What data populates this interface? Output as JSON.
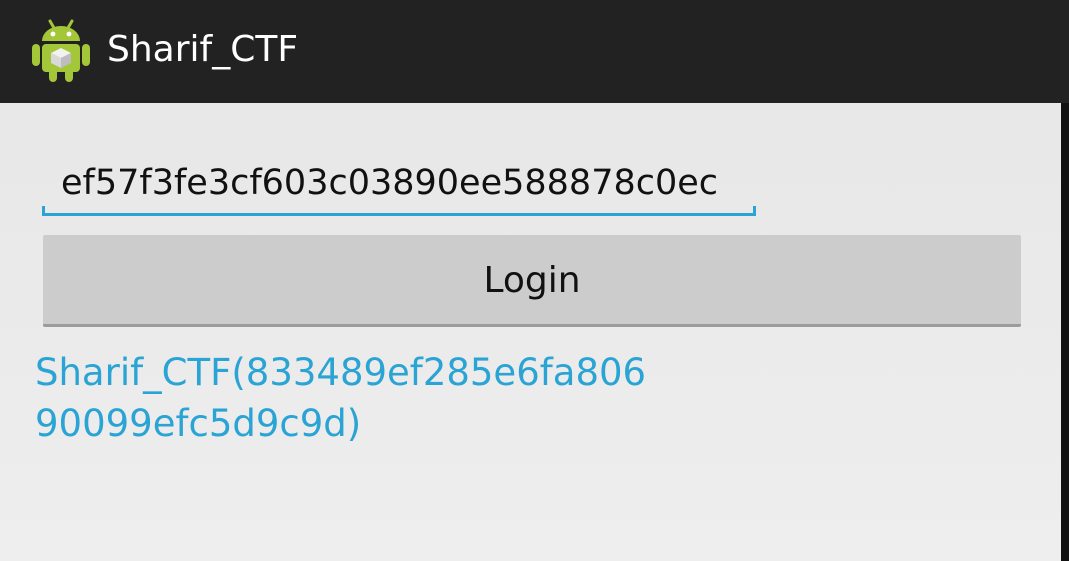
{
  "action_bar": {
    "title": "Sharif_CTF",
    "icon": "android-robot-icon",
    "background": "#222222"
  },
  "form": {
    "input_value": "ef57f3fe3cf603c03890ee588878c0ec",
    "accent_color": "#2aa4d4",
    "login_label": "Login"
  },
  "result": {
    "lines": [
      "Sharif_CTF(833489ef285e6fa806",
      "90099efc5d9c9d)"
    ],
    "color": "#2aa4d4"
  }
}
